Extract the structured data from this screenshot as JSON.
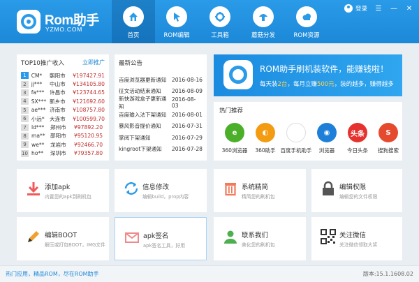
{
  "app": {
    "logo_title": "Rom助手",
    "logo_sub": "YZMO.COM"
  },
  "nav": [
    {
      "label": "首页",
      "icon": "home-icon",
      "active": true
    },
    {
      "label": "ROM编辑",
      "icon": "cursor-icon",
      "active": false
    },
    {
      "label": "工具箱",
      "icon": "toolbox-icon",
      "active": false
    },
    {
      "label": "蘑菇分发",
      "icon": "mushroom-icon",
      "active": false
    },
    {
      "label": "ROM资源",
      "icon": "cloud-icon",
      "active": false
    }
  ],
  "topbar": {
    "login_label": "登录"
  },
  "top10": {
    "title": "TOP10推广收入",
    "link": "立即推广",
    "rows": [
      {
        "rank": "1",
        "user": "CM*",
        "city": "朝阳市",
        "amount": "¥197427.91"
      },
      {
        "rank": "2",
        "user": "jj***",
        "city": "中山市",
        "amount": "¥134105.80"
      },
      {
        "rank": "3",
        "user": "fa***",
        "city": "许昌市",
        "amount": "¥123744.65"
      },
      {
        "rank": "4",
        "user": "SX***",
        "city": "新乡市",
        "amount": "¥121692.60"
      },
      {
        "rank": "5",
        "user": "ae***",
        "city": "济南市",
        "amount": "¥108757.80"
      },
      {
        "rank": "6",
        "user": "小远*",
        "city": "大连市",
        "amount": "¥100599.70"
      },
      {
        "rank": "7",
        "user": "ld***",
        "city": "郑州市",
        "amount": "¥97892.20"
      },
      {
        "rank": "8",
        "user": "ma**",
        "city": "邵阳市",
        "amount": "¥95120.95"
      },
      {
        "rank": "9",
        "user": "we**",
        "city": "龙岩市",
        "amount": "¥92466.70"
      },
      {
        "rank": "10",
        "user": "ho**",
        "city": "深圳市",
        "amount": "¥79357.80"
      }
    ]
  },
  "notices": {
    "title": "最新公告",
    "rows": [
      {
        "text": "百度浏览器更新通知",
        "date": "2016-08-16"
      },
      {
        "text": "征文活动结束通知",
        "date": "2016-08-09"
      },
      {
        "text": "新快游戏盒子更新通知",
        "date": "2016-08-03"
      },
      {
        "text": "百度输入法下架通知",
        "date": "2016-08-01"
      },
      {
        "text": "暴风影音提价通知",
        "date": "2016-07-31"
      },
      {
        "text": "掌阅下架通知",
        "date": "2016-07-29"
      },
      {
        "text": "kingroot下架通知",
        "date": "2016-07-28"
      }
    ]
  },
  "banner": {
    "title": "ROM助手刷机装软件，能赚钱啦！",
    "sub_pre": "每天装",
    "sub_num1": "2台",
    "sub_mid": "，每月立赚",
    "sub_num2": "500元",
    "sub_post": "，装的越多，赚得越多"
  },
  "hot": {
    "title": "热门推荐",
    "apps": [
      {
        "name": "360浏览器",
        "icon": "360-browser-icon",
        "color": "#4caf2a",
        "glyph": "e"
      },
      {
        "name": "360助手",
        "icon": "360-assistant-icon",
        "color": "#f39c12",
        "glyph": "◐"
      },
      {
        "name": "百度手机助手",
        "icon": "baidu-assistant-icon",
        "color": "#ffffff",
        "glyph": ""
      },
      {
        "name": "浏览器",
        "icon": "browser-icon",
        "color": "#1e7fd8",
        "glyph": "◉"
      },
      {
        "name": "今日头条",
        "icon": "toutiao-icon",
        "color": "#e6322e",
        "glyph": "头条"
      },
      {
        "name": "搜狗搜索",
        "icon": "sogou-icon",
        "color": "#e64a2e",
        "glyph": "S"
      }
    ]
  },
  "tiles": [
    {
      "title": "添加apk",
      "sub": "内置您的apk到刷机包",
      "icon": "download-icon",
      "color": "#f05a5a"
    },
    {
      "title": "信息修改",
      "sub": "编辑build，prop内容",
      "icon": "refresh-icon",
      "color": "#2a9be8"
    },
    {
      "title": "系统精简",
      "sub": "精简您的刷机包",
      "icon": "trash-icon",
      "color": "#f07a5a"
    },
    {
      "title": "编辑权限",
      "sub": "编辑您的文件权限",
      "icon": "lock-icon",
      "color": "#555555"
    },
    {
      "title": "编辑BOOT",
      "sub": "解压或打包BOOT，IMG文件",
      "icon": "pencil-icon",
      "color": "#f0a030"
    },
    {
      "title": "apk签名",
      "sub": "apk签名工具，好用",
      "icon": "mail-icon",
      "color": "#f08a8a"
    },
    {
      "title": "联系我们",
      "sub": "美化您的刷机包",
      "icon": "user-icon",
      "color": "#4caf50"
    },
    {
      "title": "关注微信",
      "sub": "关注微信领取大奖",
      "icon": "qrcode-icon",
      "color": "#333333"
    }
  ],
  "footer": {
    "left": "热门应用，精品ROM，尽在ROM助手",
    "version": "版本:15.1.1608.02"
  }
}
